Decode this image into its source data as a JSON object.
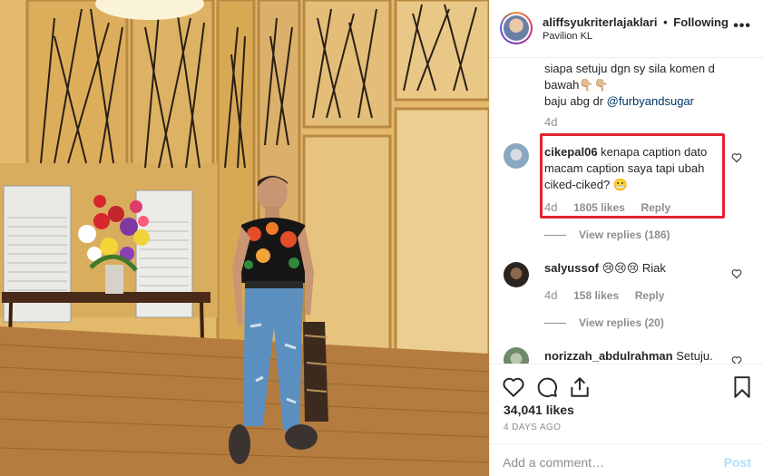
{
  "header": {
    "username": "aliffsyukriterlajaklari",
    "separator": "•",
    "follow_status": "Following",
    "location": "Pavilion KL",
    "more_icon": "more-dots-icon"
  },
  "caption": {
    "line1": "siapa setuju dgn sy sila komen d",
    "line2_text": "bawah",
    "line2_emoji": "👇🏼👇🏼",
    "line3_prefix": "baju abg dr ",
    "mention": "@furbyandsugar",
    "age": "4d"
  },
  "comments": [
    {
      "username": "cikepal06",
      "text": "kenapa caption dato macam caption saya tapi ubah ciked-ciked? 😬",
      "age": "4d",
      "likes": "1805 likes",
      "reply": "Reply",
      "view_replies": "View replies (186)"
    },
    {
      "username": "salyussof",
      "text": "😢😢😢 Riak",
      "age": "4d",
      "likes": "158 likes",
      "reply": "Reply",
      "view_replies": "View replies (20)"
    },
    {
      "username": "norizzah_abdulrahman",
      "text": "Setuju."
    }
  ],
  "actions": {
    "like_icon": "heart-icon",
    "comment_icon": "comment-icon",
    "share_icon": "share-icon",
    "save_icon": "bookmark-icon",
    "likes_count": "34,041 likes",
    "timestamp": "4 DAYS AGO"
  },
  "add_comment": {
    "placeholder": "Add a comment…",
    "post_label": "Post"
  },
  "colors": {
    "highlight_border": "#e0242f",
    "post_disabled": "#b2dffc",
    "mention": "#003569"
  }
}
